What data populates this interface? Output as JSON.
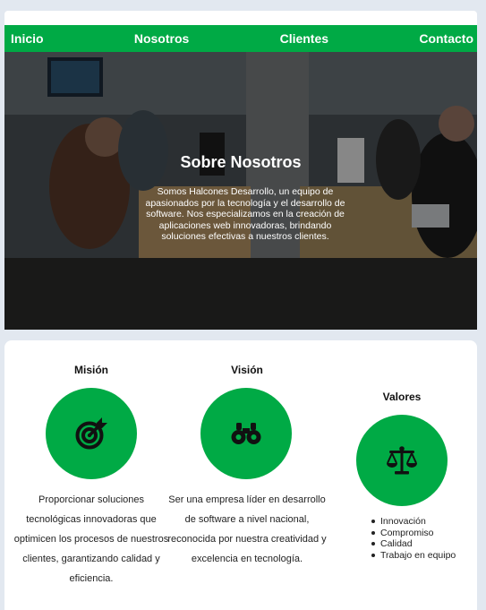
{
  "nav": {
    "items": [
      "Inicio",
      "Nosotros",
      "Clientes",
      "Contacto"
    ]
  },
  "hero": {
    "title": "Sobre Nosotros",
    "text": "Somos Halcones Desarrollo, un equipo de apasionados por la tecnología y el desarrollo de software. Nos especializamos en la creación de aplicaciones web innovadoras, brindando soluciones efectivas a nuestros clientes."
  },
  "sections": {
    "mision": {
      "title": "Misión",
      "icon": "target-icon",
      "text": "Proporcionar soluciones tecnológicas innovadoras que optimicen los procesos de nuestros clientes, garantizando calidad y eficiencia."
    },
    "vision": {
      "title": "Visión",
      "icon": "binoculars-icon",
      "text": "Ser una empresa líder en desarrollo de software a nivel nacional, reconocida por nuestra creatividad y excelencia en tecnología."
    },
    "valores": {
      "title": "Valores",
      "icon": "scale-icon",
      "items": [
        "Innovación",
        "Compromiso",
        "Calidad",
        "Trabajo en equipo"
      ]
    }
  },
  "colors": {
    "accent": "#00aa45",
    "page_background": "#e2e8f0",
    "card": "#ffffff"
  }
}
